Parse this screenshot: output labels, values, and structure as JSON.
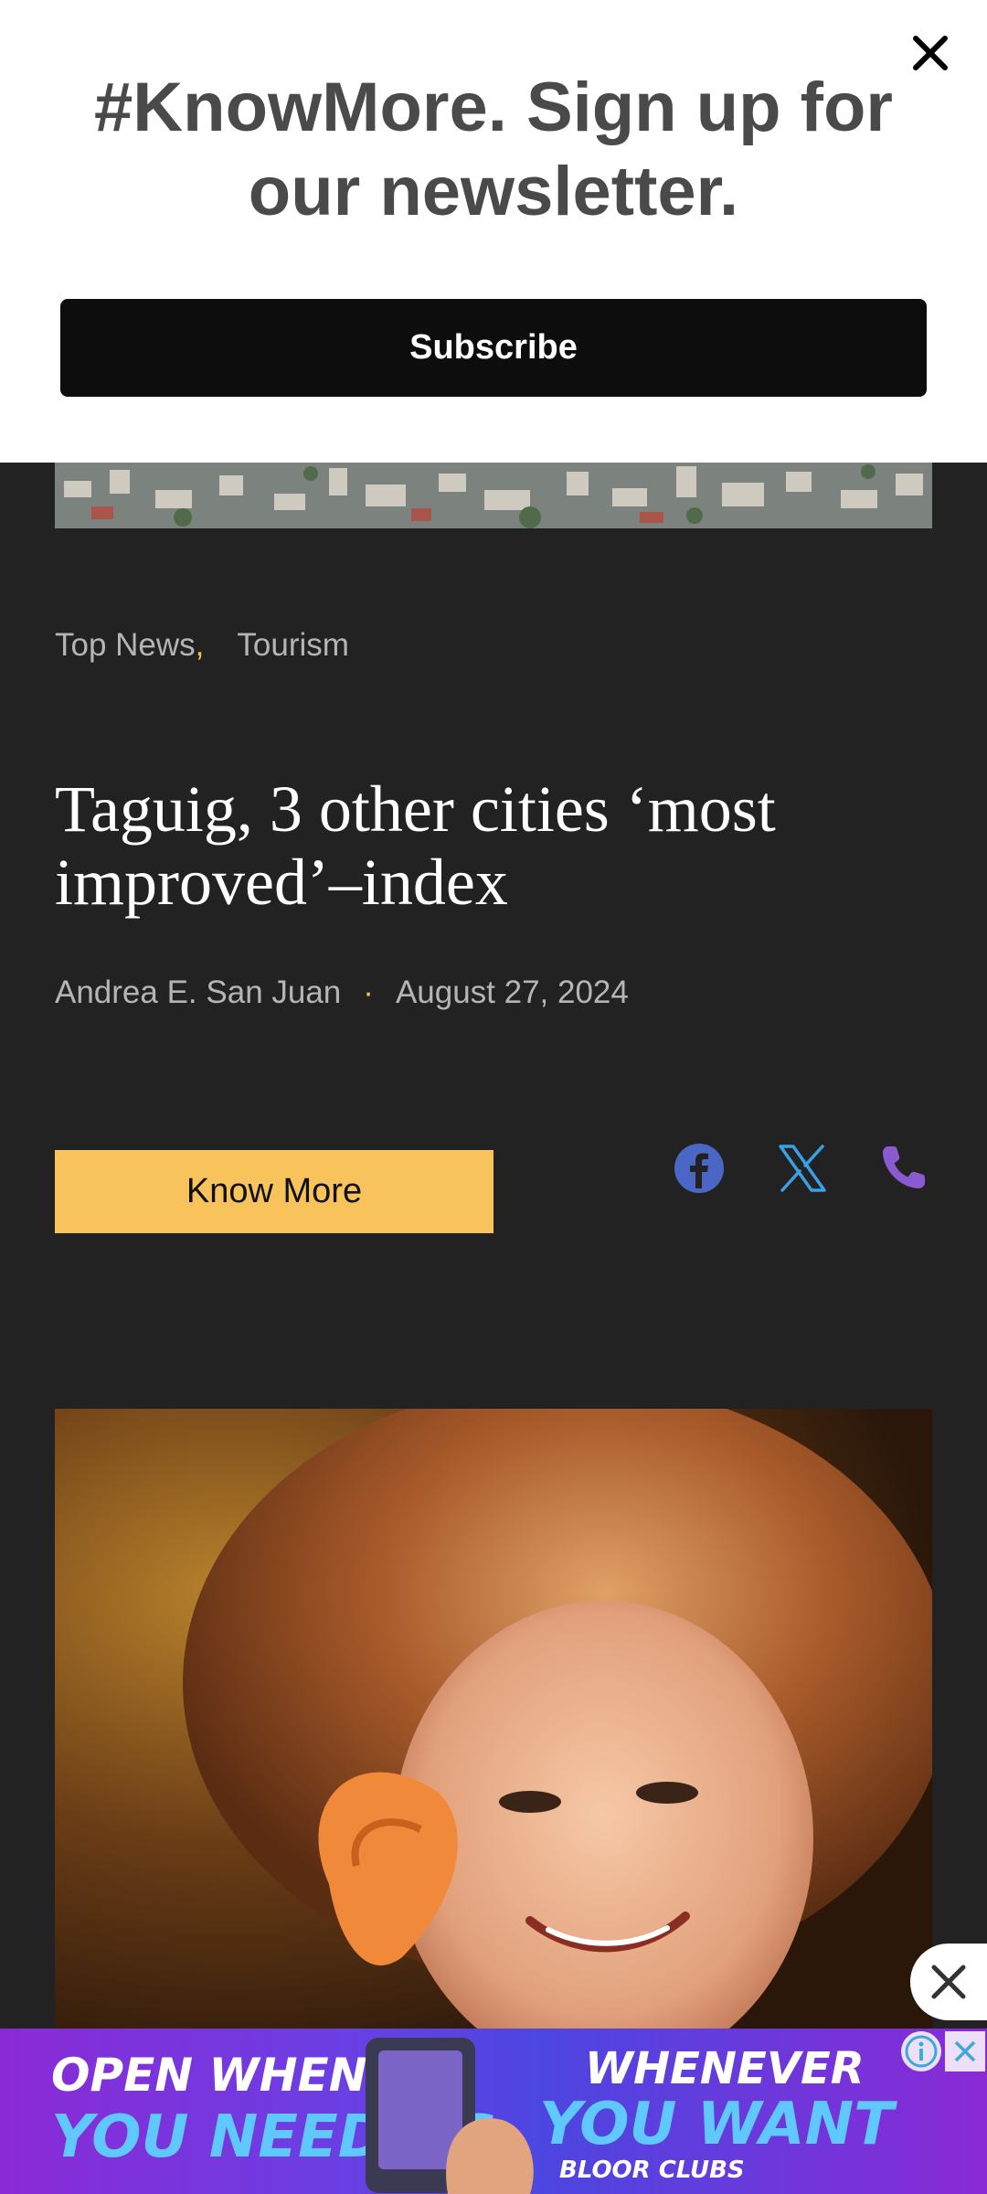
{
  "newsletter": {
    "headline": "#KnowMore. Sign up for our newsletter.",
    "subscribe_label": "Subscribe"
  },
  "article": {
    "categories": [
      "Top News",
      "Tourism"
    ],
    "category_separator": ",",
    "title": "Taguig, 3 other cities ‘most improved’–index",
    "author": "Andrea E. San Juan",
    "byline_separator": "·",
    "date": "August 27, 2024",
    "know_more_label": "Know More"
  },
  "social": {
    "icons": [
      "facebook-icon",
      "x-icon",
      "phone-icon"
    ]
  },
  "ad": {
    "line1a": "OPEN WHEN",
    "line1b": "YOU NEED US",
    "line2a": "WHENEVER",
    "line2b": "YOU WANT",
    "brand": "BLOOR CLUBS"
  },
  "colors": {
    "page_background": "#222223",
    "accent_yellow": "#f7c35a",
    "facebook_blue": "#4a67c6",
    "x_blue": "#3aa0e6",
    "phone_purple": "#8a5bd0",
    "ad_purple": "#8a2ad6"
  }
}
